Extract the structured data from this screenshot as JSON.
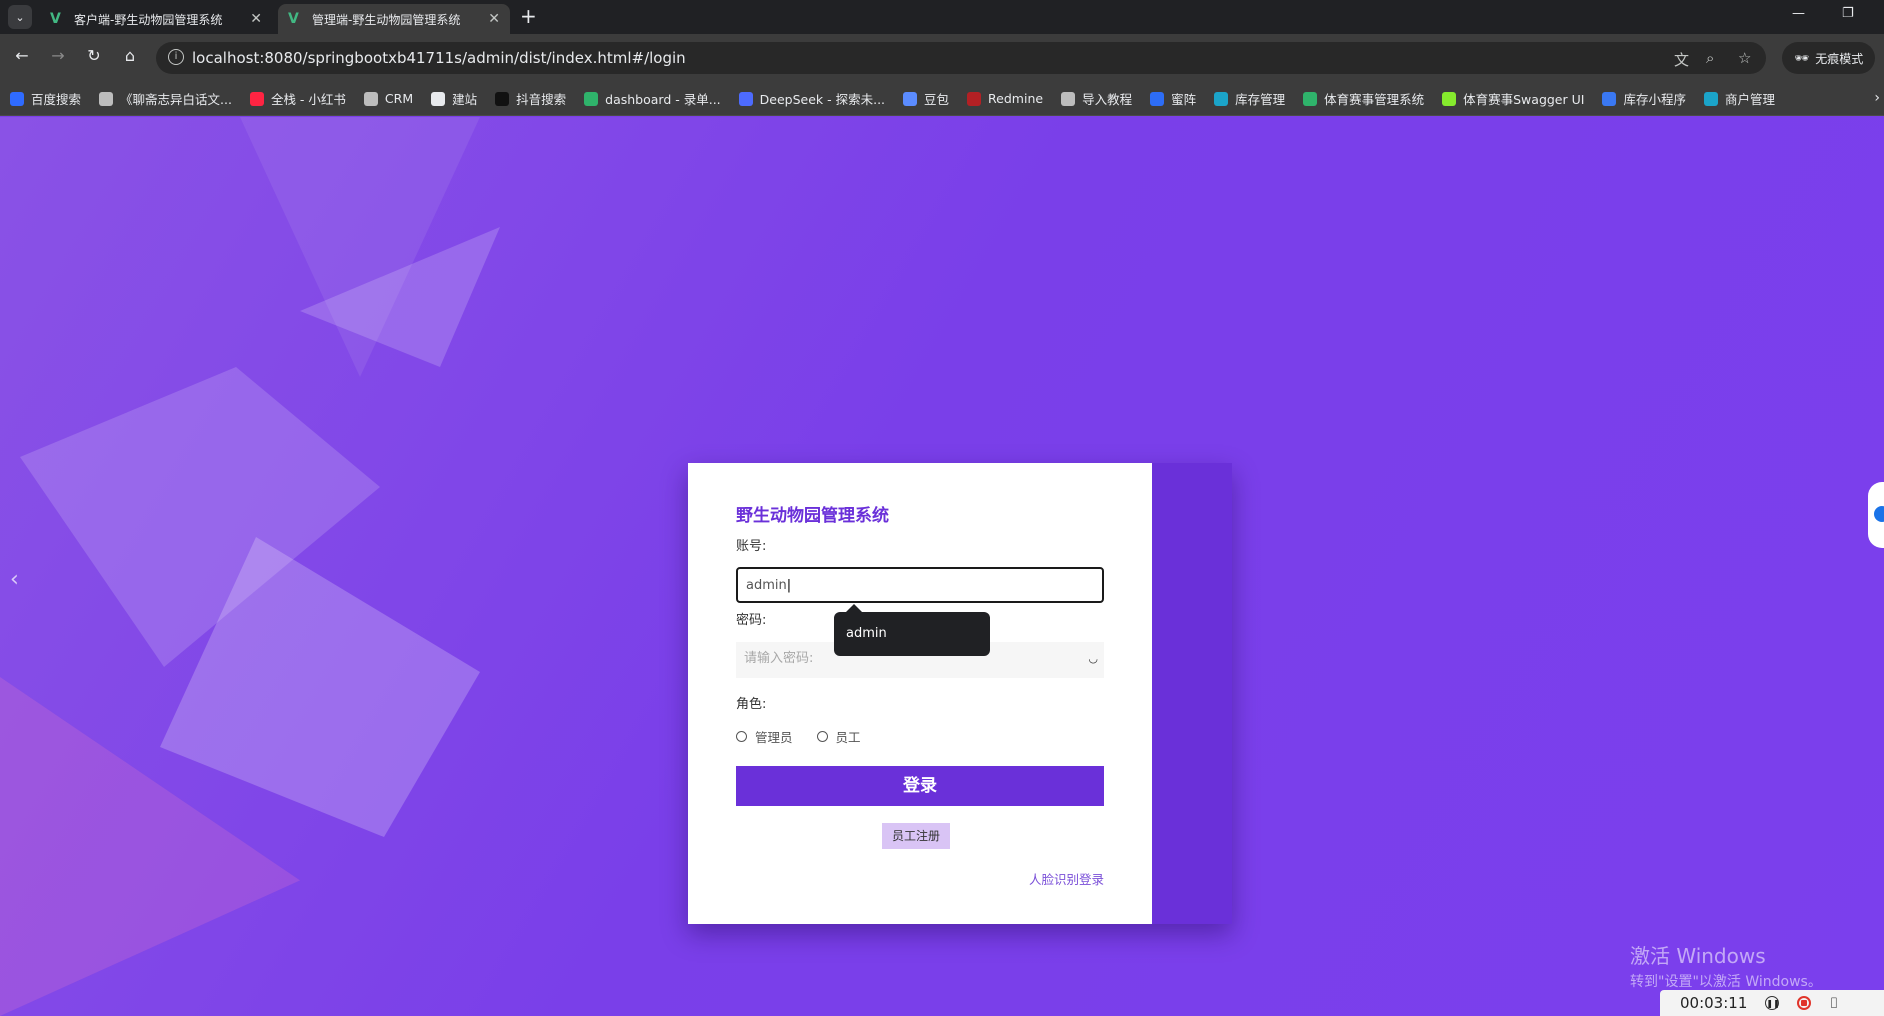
{
  "browser": {
    "tabs": [
      {
        "title": "客户端-野生动物园管理系统",
        "active": false
      },
      {
        "title": "管理端-野生动物园管理系统",
        "active": true
      }
    ],
    "url": "localhost:8080/springbootxb41711s/admin/dist/index.html#/login",
    "incognito_label": "无痕模式",
    "bookmarks": [
      {
        "label": "百度搜索",
        "icon": "baidu-icon",
        "color": "#2f6bff"
      },
      {
        "label": "《聊斋志异白话文...",
        "icon": "globe-icon",
        "color": "#bdbdbd"
      },
      {
        "label": "全栈 - 小红书",
        "icon": "xiaohongshu-icon",
        "color": "#ff2442"
      },
      {
        "label": "CRM",
        "icon": "globe-icon",
        "color": "#bdbdbd"
      },
      {
        "label": "建站",
        "icon": "site-icon",
        "color": "#e8eaed"
      },
      {
        "label": "抖音搜索",
        "icon": "douyin-icon",
        "color": "#111111"
      },
      {
        "label": "dashboard - 录单...",
        "icon": "leaf-icon",
        "color": "#2fb36b"
      },
      {
        "label": "DeepSeek - 探索未...",
        "icon": "deepseek-icon",
        "color": "#4d6bfe"
      },
      {
        "label": "豆包",
        "icon": "doubao-icon",
        "color": "#5b8cff"
      },
      {
        "label": "Redmine",
        "icon": "redmine-icon",
        "color": "#b32024"
      },
      {
        "label": "导入教程",
        "icon": "globe-icon",
        "color": "#bdbdbd"
      },
      {
        "label": "蜜阵",
        "icon": "shield-icon",
        "color": "#2d6df6"
      },
      {
        "label": "库存管理",
        "icon": "app-icon",
        "color": "#1ba4c9"
      },
      {
        "label": "体育赛事管理系统",
        "icon": "leaf-icon",
        "color": "#2fb36b"
      },
      {
        "label": "体育赛事Swagger UI",
        "icon": "swagger-icon",
        "color": "#85ea2d"
      },
      {
        "label": "库存小程序",
        "icon": "triangle-icon",
        "color": "#3a78f2"
      },
      {
        "label": "商户管理",
        "icon": "app-icon",
        "color": "#1ba4c9"
      }
    ]
  },
  "login": {
    "title": "野生动物园管理系统",
    "account_label": "账号:",
    "account_value": "admin",
    "autocomplete_suggestion": "admin",
    "password_label": "密码:",
    "password_placeholder": "请输入密码:",
    "role_label": "角色:",
    "roles": [
      "管理员",
      "员工"
    ],
    "login_button": "登录",
    "register_button": "员工注册",
    "face_login_link": "人脸识别登录"
  },
  "overlay": {
    "watermark_line1": "激活 Windows",
    "watermark_line2": "转到\"设置\"以激活 Windows。",
    "recorder_time": "00:03:11"
  },
  "colors": {
    "accent": "#6a30d9",
    "page_background": "#7b3fe8",
    "register_button_bg": "#d9c4f5"
  }
}
